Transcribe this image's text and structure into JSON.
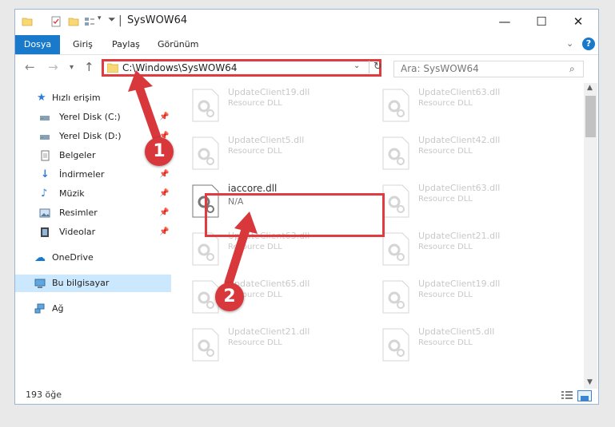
{
  "window": {
    "title": "SysWOW64",
    "title_separator": "|",
    "controls": {
      "minimize": "—",
      "maximize": "☐",
      "close": "✕"
    }
  },
  "ribbon": {
    "tabs": [
      "Dosya",
      "Giriş",
      "Paylaş",
      "Görünüm"
    ],
    "active_tab": "Dosya",
    "help": "?"
  },
  "address": {
    "path": "C:\\Windows\\SysWOW64",
    "search_placeholder": "Ara: SysWOW64"
  },
  "nav_pane": {
    "quick_access": "Hızlı erişim",
    "items": [
      {
        "label": "Yerel Disk (C:)",
        "icon": "drive-icon",
        "pinned": true
      },
      {
        "label": "Yerel Disk (D:)",
        "icon": "drive-icon",
        "pinned": true
      },
      {
        "label": "Belgeler",
        "icon": "documents-icon",
        "pinned": true
      },
      {
        "label": "İndirmeler",
        "icon": "downloads-icon",
        "pinned": true
      },
      {
        "label": "Müzik",
        "icon": "music-icon",
        "pinned": true
      },
      {
        "label": "Resimler",
        "icon": "pictures-icon",
        "pinned": true
      },
      {
        "label": "Videolar",
        "icon": "videos-icon",
        "pinned": true
      }
    ],
    "onedrive": "OneDrive",
    "this_pc": "Bu bilgisayar",
    "network": "Ağ"
  },
  "files": {
    "left_column": [
      {
        "name": "UpdateClient19.dll",
        "type": "Resource DLL"
      },
      {
        "name": "UpdateClient5.dll",
        "type": "Resource DLL"
      },
      {
        "name": "iaccore.dll",
        "type": "N/A"
      },
      {
        "name": "UpdateClient63.dll",
        "type": "Resource DLL"
      },
      {
        "name": "UpdateClient65.dll",
        "type": "Resource DLL"
      },
      {
        "name": "UpdateClient21.dll",
        "type": "Resource DLL"
      }
    ],
    "right_column": [
      {
        "name": "UpdateClient63.dll",
        "type": "Resource DLL"
      },
      {
        "name": "UpdateClient42.dll",
        "type": "Resource DLL"
      },
      {
        "name": "UpdateClient63.dll",
        "type": "Resource DLL"
      },
      {
        "name": "UpdateClient21.dll",
        "type": "Resource DLL"
      },
      {
        "name": "UpdateClient19.dll",
        "type": "Resource DLL"
      },
      {
        "name": "UpdateClient5.dll",
        "type": "Resource DLL"
      }
    ]
  },
  "status": {
    "item_count": "193 öğe"
  },
  "annotations": {
    "step1": "1",
    "step2": "2",
    "color": "#d8383b"
  }
}
